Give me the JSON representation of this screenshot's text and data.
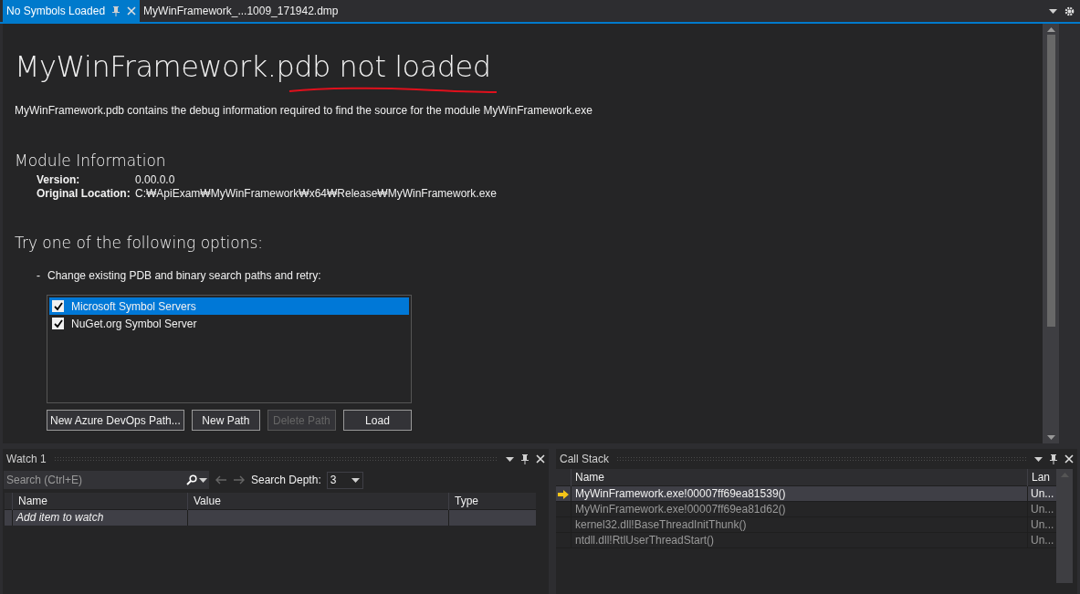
{
  "tabs": [
    {
      "label": "No Symbols Loaded",
      "selected": true
    },
    {
      "label": "MyWinFramework_...1009_171942.dmp",
      "selected": false
    }
  ],
  "document": {
    "title": "MyWinFramework.pdb not loaded",
    "description": "MyWinFramework.pdb contains the debug information required to find the source for the module MyWinFramework.exe",
    "module_heading": "Module Information",
    "fields": [
      {
        "label": "Version:",
        "value": "0.00.0.0"
      },
      {
        "label": "Original Location:",
        "value": "C:₩ApiExam₩MyWinFramework₩x64₩Release₩MyWinFramework.exe"
      }
    ],
    "options_heading": "Try one of the following options:",
    "option_bullet": "-",
    "option_text": "Change existing PDB and binary search paths and retry:",
    "symbol_servers": [
      {
        "label": "Microsoft Symbol Servers",
        "checked": true,
        "selected": true
      },
      {
        "label": "NuGet.org Symbol Server",
        "checked": true,
        "selected": false
      }
    ],
    "buttons": [
      {
        "label": "New Azure DevOps Path...",
        "disabled": false
      },
      {
        "label": "New Path",
        "disabled": false
      },
      {
        "label": "Delete Path",
        "disabled": true
      },
      {
        "label": "Load",
        "disabled": false
      }
    ]
  },
  "watch": {
    "title": "Watch 1",
    "search_placeholder": "Search (Ctrl+E)",
    "search_depth_label": "Search Depth:",
    "search_depth": "3",
    "columns": [
      "Name",
      "Value",
      "Type"
    ],
    "rows": [
      {
        "name": "Add item to watch"
      }
    ]
  },
  "call_stack": {
    "title": "Call Stack",
    "columns": [
      "Name",
      "Lan"
    ],
    "rows": [
      {
        "name": "MyWinFramework.exe!00007ff69ea81539()",
        "lang": "Un...",
        "current": true
      },
      {
        "name": "MyWinFramework.exe!00007ff69ea81d62()",
        "lang": "Un...",
        "current": false
      },
      {
        "name": "kernel32.dll!BaseThreadInitThunk()",
        "lang": "Un...",
        "current": false
      },
      {
        "name": "ntdll.dll!RtlUserThreadStart()",
        "lang": "Un...",
        "current": false
      }
    ]
  }
}
